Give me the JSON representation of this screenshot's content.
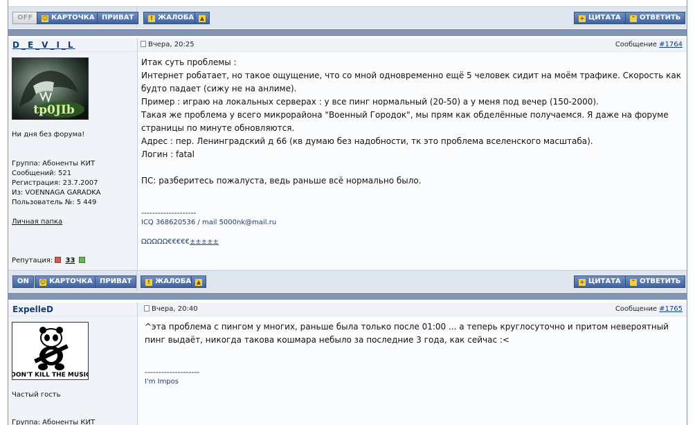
{
  "colors": {
    "bar": "#dfe6ef",
    "separator": "#8394b2",
    "button": "#4a6cab",
    "link": "#163b7a"
  },
  "top_bar": {
    "online": "OFF",
    "card": "КАРТОЧКА",
    "private": "ПРИВАТ",
    "report": "ЖАЛОБА",
    "quote": "ЦИТАТА",
    "reply": "ОТВЕТИТЬ"
  },
  "posts": [
    {
      "author": "D_E_V_I_L",
      "date": "Вчера, 20:25",
      "message_label": "Сообщение",
      "message_num": "#1764",
      "avatar_icon": "avatar-fantasy-creature-tp0jib",
      "avatar_text": "tp0JIb",
      "tagline": "Ни дня без форума!",
      "group": "Группа: Абоненты КИТ",
      "posts_count": "Сообщений: 521",
      "registered": "Регистрация: 23.7.2007",
      "from": "Из: VOENNAGA GARADKA",
      "user_no": "Пользователь №: 5 449",
      "folder": "Личная папка",
      "rep_label": "Репутация:",
      "rep_value": "33",
      "lines": [
        "Итак суть проблемы :",
        "Интернет робатает, но такое ощущение, что со мной одновременно ещё 5 человек сидит на моём трафике. Скорость как будто падает (сижу не на анлиме).",
        "Пример : играю на локальных серверах : у все пинг нормальный (20-50) а у меня под вечер (150-2000).",
        "Такая же проблема у всего микрорайона \"Военный Городок\", мы прям как обделённые получаемся. Я даже на форуме страницы по минуте обновляются.",
        "Адрес : пер. Ленинградский д 66 (кв думаю без надобности, тк это проблема вселенского масштаба).",
        "Логин : fatal",
        "ПС: разберитесь пожалуста, ведь раньше всё нормально было."
      ],
      "sig_dash": "--------------------",
      "sig_line1": "ICQ 368620536 / mail 5000nk@mail.ru",
      "sig_line2a": "ΩΩΩΩΩ€€€€€",
      "sig_line2b": "±±±±±"
    },
    {
      "author": "ExpelleD",
      "date": "Вчера, 20:40",
      "message_label": "Сообщение",
      "message_num": "#1765",
      "avatar_icon": "avatar-panda-guitar",
      "avatar_text": "DON'T KILL THE MUSIC",
      "tagline": "Частый гость",
      "group": "Группа: Абоненты КИТ",
      "lines": [
        "^эта проблема с пингом у многих, раньше была только после 01:00 ... а теперь круглосуточно и притом невероятный пинг выдаёт, никогда такова кошмара небыло за последние 3 года, как сейчас :<"
      ],
      "sig_dash": "--------------------",
      "sig_line1": "I'm Impos"
    }
  ],
  "mid_bar": {
    "online": "ON",
    "card": "КАРТОЧКА",
    "private": "ПРИВАТ",
    "report": "ЖАЛОБА",
    "quote": "ЦИТАТА",
    "reply": "ОТВЕТИТЬ"
  }
}
